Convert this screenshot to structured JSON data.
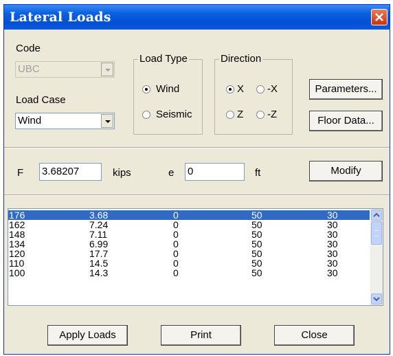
{
  "window": {
    "title": "Lateral Loads"
  },
  "code": {
    "label": "Code",
    "value": "UBC"
  },
  "load_case": {
    "label": "Load Case",
    "value": "Wind"
  },
  "load_type": {
    "title": "Load Type",
    "options": [
      "Wind",
      "Seismic"
    ],
    "selected": "Wind"
  },
  "direction": {
    "title": "Direction",
    "options": [
      "X",
      "-X",
      "Z",
      "-Z"
    ],
    "selected": "X"
  },
  "buttons": {
    "parameters": "Parameters...",
    "floor_data": "Floor Data...",
    "modify": "Modify",
    "apply_loads": "Apply Loads",
    "print": "Print",
    "close": "Close"
  },
  "force": {
    "label": "F",
    "value": "3.68207",
    "unit": "kips"
  },
  "eccentricity": {
    "label": "e",
    "value": "0",
    "unit": "ft"
  },
  "table": {
    "rows": [
      [
        "176",
        "3.68",
        "0",
        "50",
        "30"
      ],
      [
        "162",
        "7.24",
        "0",
        "50",
        "30"
      ],
      [
        "148",
        "7.11",
        "0",
        "50",
        "30"
      ],
      [
        "134",
        "6.99",
        "0",
        "50",
        "30"
      ],
      [
        "120",
        "17.7",
        "0",
        "50",
        "30"
      ],
      [
        "110",
        "14.5",
        "0",
        "50",
        "30"
      ],
      [
        "100",
        "14.3",
        "0",
        "50",
        "30"
      ]
    ],
    "selected_row": 0
  },
  "colors": {
    "title_bar": "#0a5fe0",
    "selection": "#316ac5",
    "dialog_bg": "#ece9d8"
  }
}
